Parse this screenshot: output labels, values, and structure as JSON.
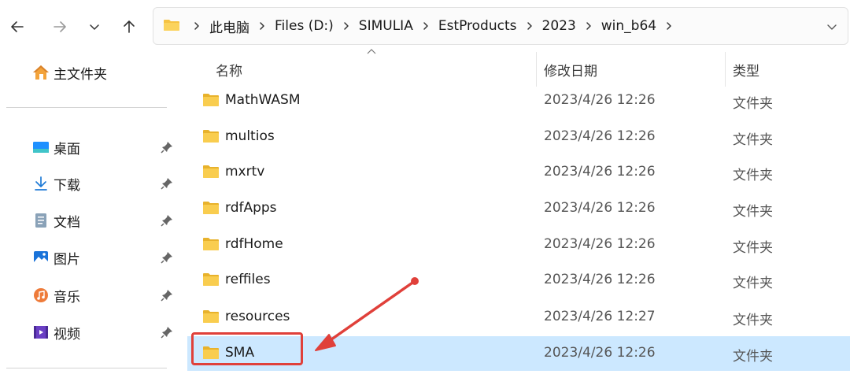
{
  "toolbar": {
    "back_icon": "arrow-left-icon",
    "forward_icon": "arrow-right-icon",
    "recent_icon": "chevron-down-icon",
    "up_icon": "arrow-up-icon"
  },
  "address": {
    "crumbs": [
      "此电脑",
      "Files (D:)",
      "SIMULIA",
      "EstProducts",
      "2023",
      "win_b64"
    ]
  },
  "sidebar": {
    "home_label": "主文件夹",
    "items": [
      {
        "label": "桌面",
        "icon": "desktop-icon"
      },
      {
        "label": "下载",
        "icon": "download-icon"
      },
      {
        "label": "文档",
        "icon": "document-icon"
      },
      {
        "label": "图片",
        "icon": "pictures-icon"
      },
      {
        "label": "音乐",
        "icon": "music-icon"
      },
      {
        "label": "视频",
        "icon": "video-icon"
      }
    ]
  },
  "columns": {
    "name": "名称",
    "date": "修改日期",
    "type": "类型"
  },
  "files": [
    {
      "name": "MathWASM",
      "date": "2023/4/26 12:26",
      "type": "文件夹"
    },
    {
      "name": "multios",
      "date": "2023/4/26 12:26",
      "type": "文件夹"
    },
    {
      "name": "mxrtv",
      "date": "2023/4/26 12:26",
      "type": "文件夹"
    },
    {
      "name": "rdfApps",
      "date": "2023/4/26 12:26",
      "type": "文件夹"
    },
    {
      "name": "rdfHome",
      "date": "2023/4/26 12:26",
      "type": "文件夹"
    },
    {
      "name": "reffiles",
      "date": "2023/4/26 12:26",
      "type": "文件夹"
    },
    {
      "name": "resources",
      "date": "2023/4/26 12:27",
      "type": "文件夹"
    },
    {
      "name": "SMA",
      "date": "2023/4/26 12:26",
      "type": "文件夹",
      "selected": true
    }
  ],
  "colors": {
    "selection": "#cce8ff",
    "annotation": "#e0403a",
    "folder": "#f6c342"
  }
}
